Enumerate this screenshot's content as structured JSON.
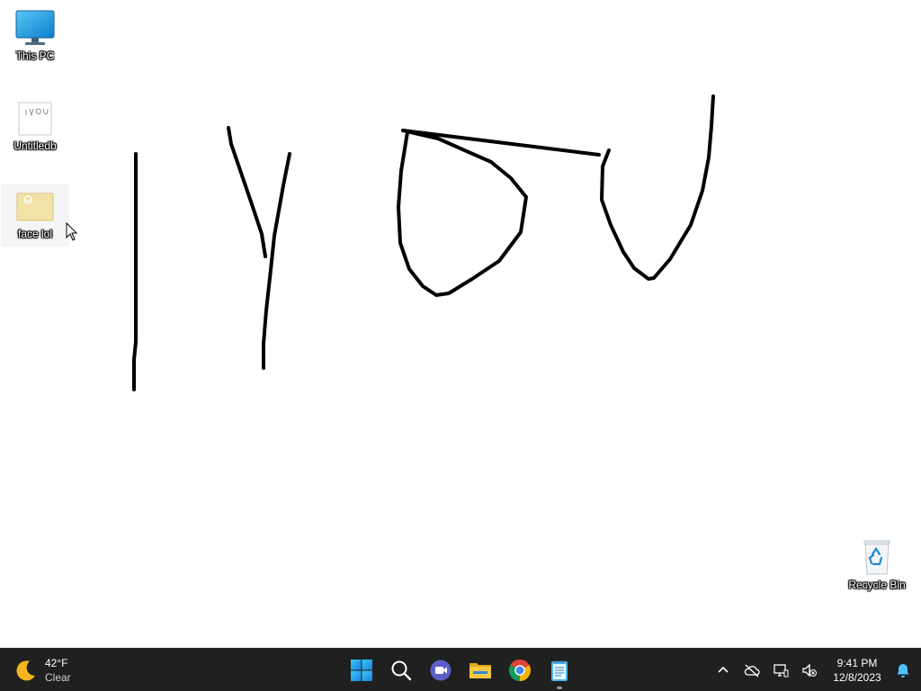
{
  "desktop": {
    "icons": [
      {
        "label": "This PC"
      },
      {
        "label": "Untitledb"
      },
      {
        "label": "face lol"
      },
      {
        "label": "Recycle Bin"
      }
    ],
    "drawing_text": "IYOU"
  },
  "taskbar": {
    "weather": {
      "temp": "42°F",
      "condition": "Clear"
    },
    "apps": [
      {
        "name": "start"
      },
      {
        "name": "search"
      },
      {
        "name": "meet-chat"
      },
      {
        "name": "file-explorer"
      },
      {
        "name": "google-chrome"
      },
      {
        "name": "notepad"
      }
    ],
    "clock": {
      "time": "9:41 PM",
      "date": "12/8/2023"
    }
  },
  "colors": {
    "taskbar_bg": "#202020",
    "start_blue": "#1a90e6",
    "folder_yellow": "#f4c640",
    "teams_purple": "#5b5fc7"
  }
}
